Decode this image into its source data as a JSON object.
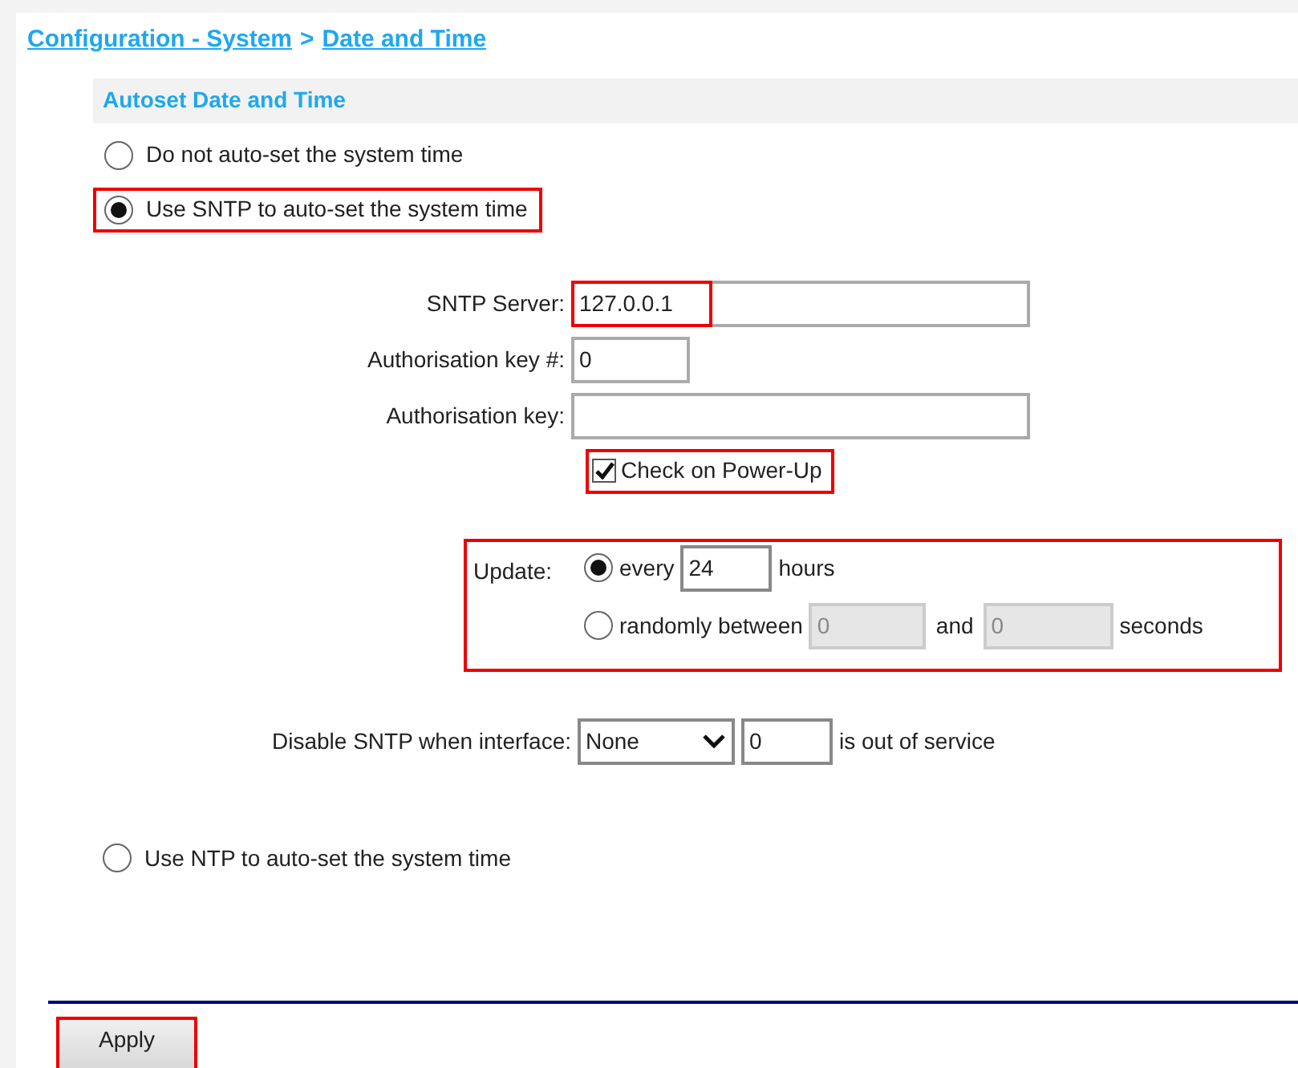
{
  "breadcrumb": {
    "parent": "Configuration - System",
    "separator": ">",
    "current": "Date and Time"
  },
  "section_title": "Autoset Date and Time",
  "mode_options": [
    {
      "label": "Do not auto-set the system time",
      "selected": false,
      "highlighted": false
    },
    {
      "label": "Use SNTP to auto-set the system time",
      "selected": true,
      "highlighted": true
    }
  ],
  "sntp": {
    "server": {
      "label": "SNTP Server:",
      "value": "127.0.0.1",
      "highlighted": true
    },
    "auth_key_number": {
      "label": "Authorisation key #:",
      "value": "0"
    },
    "auth_key": {
      "label": "Authorisation key:"
    },
    "check_on_power_up": {
      "label": "Check on Power-Up",
      "checked": true,
      "highlighted": true
    },
    "update": {
      "label": "Update:",
      "highlighted": true,
      "every": {
        "selected": true,
        "label": "every",
        "value": "24",
        "unit": "hours"
      },
      "random": {
        "selected": false,
        "label": "randomly between",
        "from": "0",
        "and": "and",
        "to": "0",
        "unit": "seconds",
        "disabled": true
      }
    },
    "disable": {
      "label": "Disable SNTP when interface:",
      "interface": "None",
      "number": "0",
      "suffix": "is out of service"
    }
  },
  "ntp_option": {
    "label": "Use NTP to auto-set the system time",
    "selected": false
  },
  "apply_button": {
    "label": "Apply",
    "highlighted": true
  }
}
